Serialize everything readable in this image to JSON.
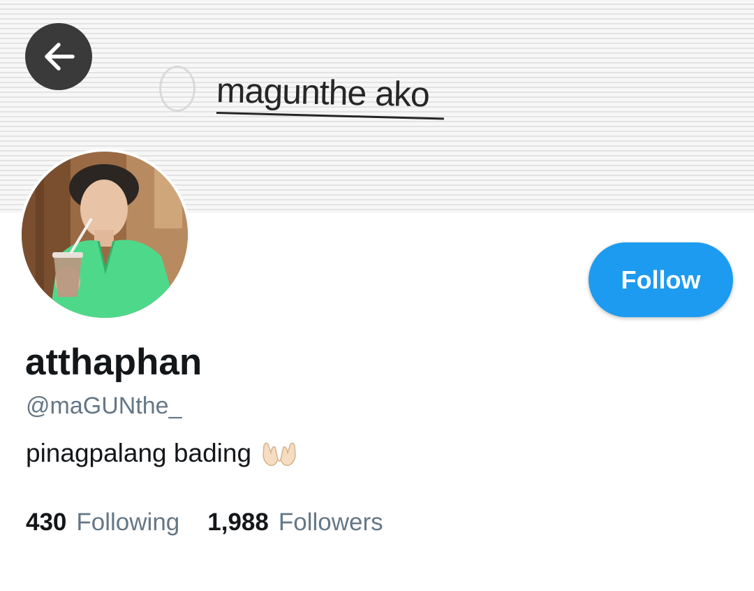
{
  "banner": {
    "option_text": "magunthe ako"
  },
  "header": {
    "back_icon": "arrow-left-icon"
  },
  "profile": {
    "display_name": "atthaphan",
    "handle": "@maGUNthe_",
    "bio_text": "pinagpalang bading",
    "bio_emoji": "palms-up-together-icon",
    "follow_label": "Follow",
    "stats": {
      "following_count": "430",
      "following_label": "Following",
      "followers_count": "1,988",
      "followers_label": "Followers"
    }
  },
  "colors": {
    "accent": "#1d9bf0",
    "secondary_text": "#657786",
    "primary_text": "#14171a",
    "back_button_bg": "#3a3a3a"
  }
}
